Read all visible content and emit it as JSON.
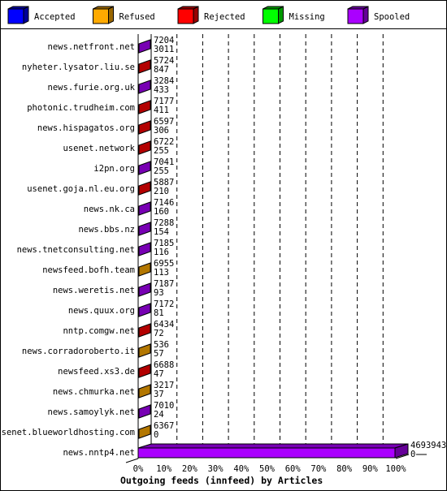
{
  "chart_data": {
    "type": "bar",
    "orientation": "horizontal",
    "stacked": true,
    "three_d": true,
    "title": "Outgoing feeds (innfeed) by Articles",
    "xlim": [
      0,
      100
    ],
    "x_ticks": [
      "0%",
      "10%",
      "20%",
      "30%",
      "40%",
      "50%",
      "60%",
      "70%",
      "80%",
      "90%",
      "100%"
    ],
    "grid": "vertical dashed",
    "legend_position": "top",
    "legend": [
      {
        "name": "Accepted",
        "color": "#0000ff"
      },
      {
        "name": "Refused",
        "color": "#ffaa00"
      },
      {
        "name": "Rejected",
        "color": "#ff0000"
      },
      {
        "name": "Missing",
        "color": "#00ff00"
      },
      {
        "name": "Spooled",
        "color": "#aa00ff"
      }
    ],
    "rows": [
      {
        "label": "news.netfront.net",
        "top": "7204",
        "bottom": "3011",
        "dominant": "Spooled"
      },
      {
        "label": "nyheter.lysator.liu.se",
        "top": "5724",
        "bottom": "847",
        "dominant": "Rejected"
      },
      {
        "label": "news.furie.org.uk",
        "top": "3284",
        "bottom": "433",
        "dominant": "Spooled"
      },
      {
        "label": "photonic.trudheim.com",
        "top": "7177",
        "bottom": "411",
        "dominant": "Rejected"
      },
      {
        "label": "news.hispagatos.org",
        "top": "6597",
        "bottom": "306",
        "dominant": "Rejected"
      },
      {
        "label": "usenet.network",
        "top": "6722",
        "bottom": "255",
        "dominant": "Rejected"
      },
      {
        "label": "i2pn.org",
        "top": "7041",
        "bottom": "255",
        "dominant": "Spooled"
      },
      {
        "label": "usenet.goja.nl.eu.org",
        "top": "5887",
        "bottom": "210",
        "dominant": "Rejected"
      },
      {
        "label": "news.nk.ca",
        "top": "7146",
        "bottom": "160",
        "dominant": "Spooled"
      },
      {
        "label": "news.bbs.nz",
        "top": "7288",
        "bottom": "154",
        "dominant": "Spooled"
      },
      {
        "label": "news.tnetconsulting.net",
        "top": "7185",
        "bottom": "116",
        "dominant": "Spooled"
      },
      {
        "label": "newsfeed.bofh.team",
        "top": "6955",
        "bottom": "113",
        "dominant": "Refused"
      },
      {
        "label": "news.weretis.net",
        "top": "7187",
        "bottom": "93",
        "dominant": "Spooled"
      },
      {
        "label": "news.quux.org",
        "top": "7172",
        "bottom": "81",
        "dominant": "Spooled"
      },
      {
        "label": "nntp.comgw.net",
        "top": "6434",
        "bottom": "72",
        "dominant": "Rejected"
      },
      {
        "label": "news.corradoroberto.it",
        "top": "536",
        "bottom": "57",
        "dominant": "Refused"
      },
      {
        "label": "newsfeed.xs3.de",
        "top": "6688",
        "bottom": "47",
        "dominant": "Rejected"
      },
      {
        "label": "news.chmurka.net",
        "top": "3217",
        "bottom": "37",
        "dominant": "Refused"
      },
      {
        "label": "news.samoylyk.net",
        "top": "7010",
        "bottom": "24",
        "dominant": "Spooled"
      },
      {
        "label": "usenet.blueworldhosting.com",
        "top": "6367",
        "bottom": "0",
        "dominant": "Refused"
      },
      {
        "label": "news.nntp4.net",
        "top": "4693943",
        "bottom": "0",
        "dominant": "Spooled",
        "spooled_percent": 100
      }
    ]
  }
}
